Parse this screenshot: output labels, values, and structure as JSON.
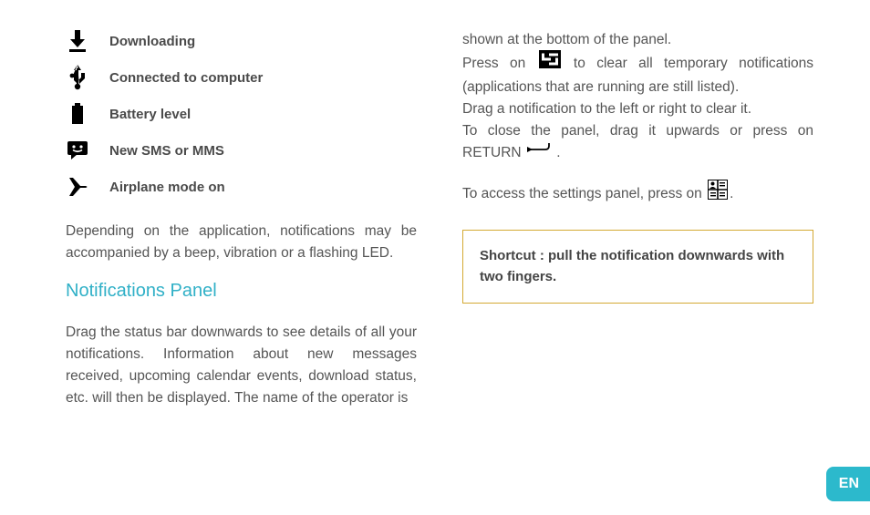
{
  "icons": [
    {
      "label": "Downloading"
    },
    {
      "label": "Connected to computer"
    },
    {
      "label": "Battery level"
    },
    {
      "label": "New SMS or MMS"
    },
    {
      "label": "Airplane mode on"
    }
  ],
  "left": {
    "para1": "Depending on the application, notifications may be accompanied by a beep, vibration or a flashing LED.",
    "heading": "Notifications Panel",
    "para2": "Drag the status bar downwards to see details of all your notifications. Information about new messages received, upcoming calendar events, download status, etc. will then be displayed. The name of the operator is"
  },
  "right": {
    "line1": "shown at the bottom of the panel.",
    "line2a": "Press on ",
    "line2b": " to clear all temporary notifications (applications that are running are still listed).",
    "line3": "Drag a notification to the left or right to clear it.",
    "line4a": "To close the panel, drag it upwards or press on RETURN ",
    "line4b": " .",
    "line5a": "To access the settings panel, press on ",
    "line5b": ".",
    "tip": "Shortcut : pull the notification downwards with two fingers."
  },
  "lang": "EN"
}
